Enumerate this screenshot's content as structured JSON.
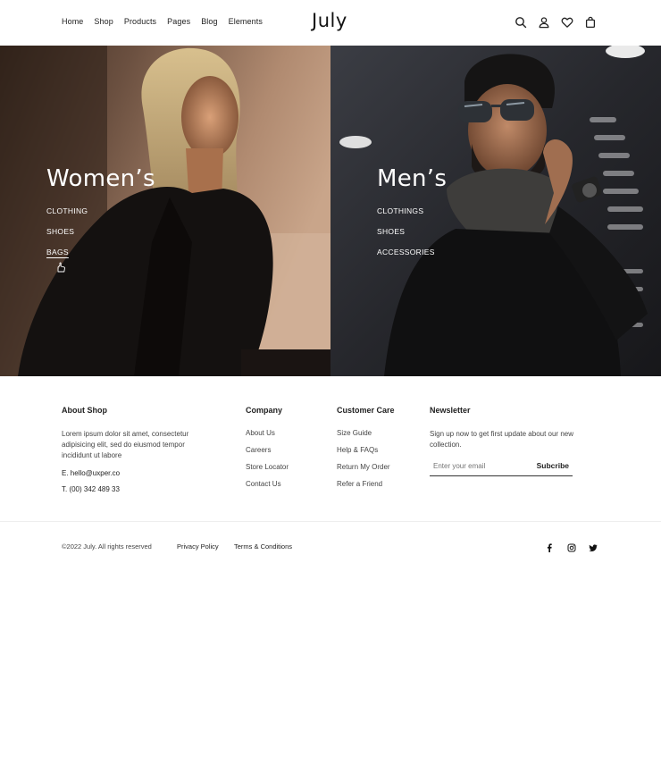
{
  "header": {
    "logo": "July",
    "nav": [
      "Home",
      "Shop",
      "Products",
      "Pages",
      "Blog",
      "Elements"
    ],
    "icons": [
      "search-icon",
      "user-icon",
      "heart-icon",
      "bag-icon"
    ]
  },
  "hero": {
    "women": {
      "title": "Women’s",
      "links": [
        "CLOTHING",
        "SHOES",
        "BAGS"
      ],
      "active_link": "BAGS"
    },
    "men": {
      "title": "Men’s",
      "links": [
        "CLOTHINGS",
        "SHOES",
        "ACCESSORIES"
      ]
    }
  },
  "footer": {
    "about": {
      "title": "About Shop",
      "text": "Lorem ipsum dolor sit amet, consectetur adipisicing elit, sed do eiusmod tempor incididunt ut labore",
      "email": "E. hello@uxper.co",
      "phone": "T. (00) 342 489 33"
    },
    "company": {
      "title": "Company",
      "links": [
        "About Us",
        "Careers",
        "Store Locator",
        "Contact Us"
      ]
    },
    "customer_care": {
      "title": "Customer Care",
      "links": [
        "Size Guide",
        "Help & FAQs",
        "Return My Order",
        "Refer a Friend"
      ]
    },
    "newsletter": {
      "title": "Newsletter",
      "text": "Sign up now to get first update about our new collection.",
      "placeholder": "Enter your email",
      "button": "Subcribe"
    }
  },
  "bottom": {
    "copyright": "©2022 July. All rights reserved",
    "privacy": "Privacy Policy",
    "terms": "Terms & Conditions",
    "social": [
      "facebook-icon",
      "instagram-icon",
      "twitter-icon"
    ]
  }
}
